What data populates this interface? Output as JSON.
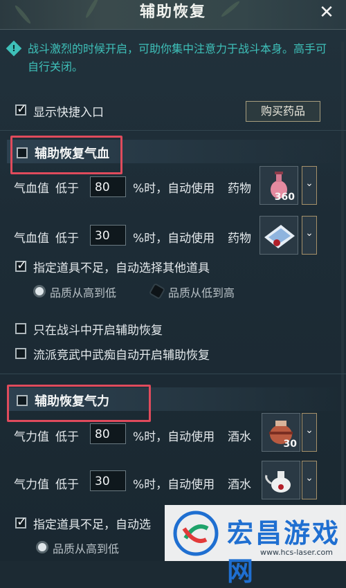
{
  "window": {
    "title": "辅助恢复",
    "close_glyph": "✕"
  },
  "info": {
    "icon": "info-diamond-icon",
    "text": "战斗激烈的时候开启，可助你集中注意力于战斗本身。高手可自行关闭。"
  },
  "shortcut": {
    "label": "显示快捷入口",
    "checked": true
  },
  "buy_button": {
    "label": "购买药品"
  },
  "hp_section": {
    "title": "辅助恢复气血",
    "checked": false,
    "rows": [
      {
        "stat": "气血值",
        "below": "低于",
        "value": "80",
        "suffix": "%时，自动使用",
        "item_type": "药物",
        "item_count": "360",
        "item_icon": "pink-potion-icon"
      },
      {
        "stat": "气血值",
        "below": "低于",
        "value": "30",
        "suffix": "%时，自动使用",
        "item_type": "药物",
        "item_count": "",
        "item_icon": "medicine-packet-icon"
      }
    ],
    "auto_select": {
      "label": "指定道具不足，自动选择其他道具",
      "checked": true
    },
    "quality_high_low": "品质从高到低",
    "quality_low_high": "品质从低到高",
    "only_in_battle": {
      "label": "只在战斗中开启辅助恢复",
      "checked": false
    },
    "arena_auto": {
      "label": "流派竞武中武痴自动开启辅助恢复",
      "checked": false
    }
  },
  "mp_section": {
    "title": "辅助恢复气力",
    "checked": false,
    "rows": [
      {
        "stat": "气力值",
        "below": "低于",
        "value": "80",
        "suffix": "%时，自动使用",
        "item_type": "酒水",
        "item_count": "30",
        "item_icon": "wine-jar-icon"
      },
      {
        "stat": "气力值",
        "below": "低于",
        "value": "30",
        "suffix": "%时，自动使用",
        "item_type": "酒水",
        "item_count": "",
        "item_icon": "teapot-icon"
      }
    ],
    "auto_select": {
      "label": "指定道具不足，自动选",
      "checked": true
    },
    "quality_high_low": "品质从高到低"
  },
  "watermark": {
    "brand": "宏昌游戏网",
    "url": "www.hcs-laser.com"
  },
  "colors": {
    "accent_teal": "#3ec0b9",
    "hp_red": "#e8556a",
    "mp_blue": "#5aa4e0",
    "highlight_box": "#e04b5c"
  }
}
